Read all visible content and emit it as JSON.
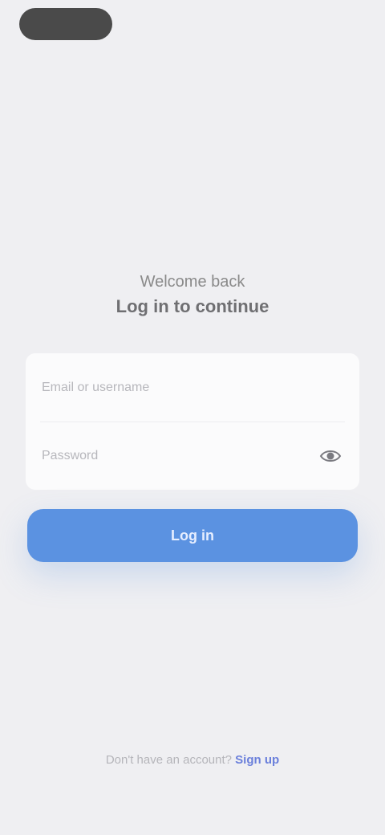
{
  "header": {
    "welcome_line1": "Welcome back",
    "welcome_line2": "Log in to continue"
  },
  "form": {
    "email_placeholder": "Email or username",
    "password_placeholder": "Password"
  },
  "actions": {
    "submit_label": "Log in"
  },
  "footer": {
    "prompt": "Don't have an account? ",
    "link_label": "Sign up"
  },
  "icons": {
    "password_toggle": "eye-icon"
  },
  "colors": {
    "background": "#EFEFF2",
    "primary": "#5B92E1",
    "link": "#6A7FDB"
  }
}
